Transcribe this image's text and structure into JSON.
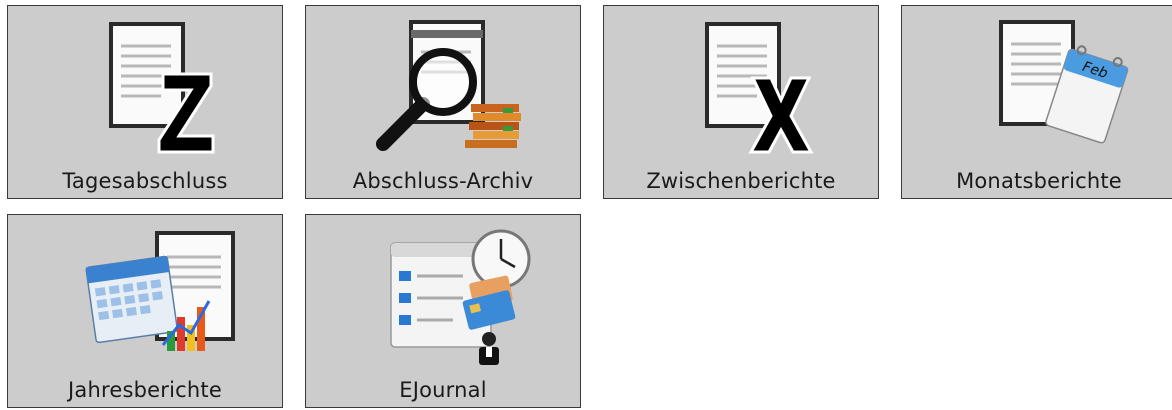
{
  "tiles": [
    {
      "label": "Tagesabschluss",
      "icon": "document-z-icon"
    },
    {
      "label": "Abschluss-Archiv",
      "icon": "document-magnifier-folders-icon"
    },
    {
      "label": "Zwischenberichte",
      "icon": "document-x-icon"
    },
    {
      "label": "Monatsberichte",
      "icon": "document-calendar-icon"
    },
    {
      "label": "Jahresberichte",
      "icon": "calendar-chart-icon"
    },
    {
      "label": "EJournal",
      "icon": "journal-clock-card-icon"
    }
  ],
  "icon_text": {
    "calendar_month": "Feb"
  },
  "colors": {
    "tile_bg": "#cccccc",
    "tile_border": "#3a3a3a",
    "calendar_blue": "#4a9be0"
  }
}
